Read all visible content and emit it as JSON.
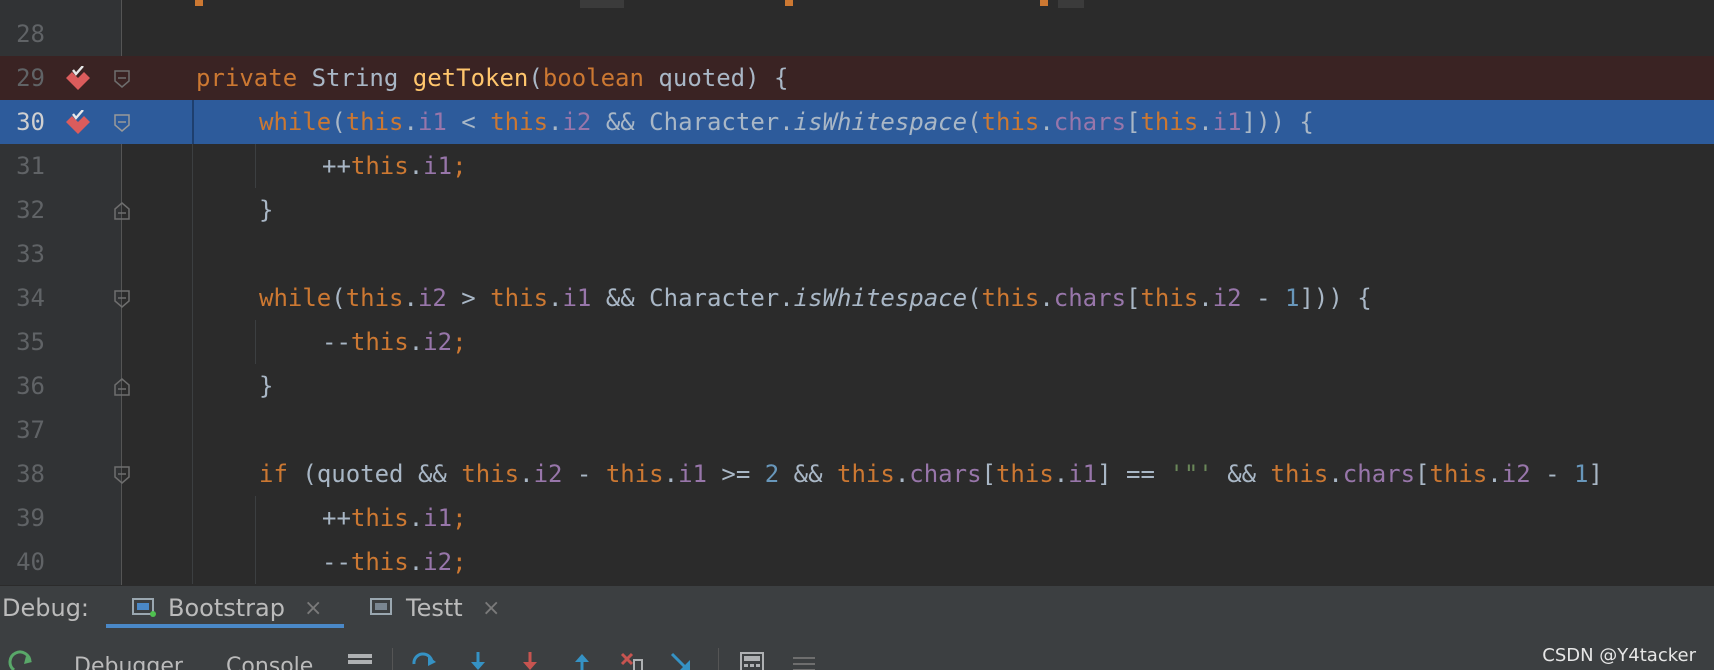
{
  "editor": {
    "lines": [
      {
        "n": "28"
      },
      {
        "n": "29"
      },
      {
        "n": "30"
      },
      {
        "n": "31"
      },
      {
        "n": "32"
      },
      {
        "n": "33"
      },
      {
        "n": "34"
      },
      {
        "n": "35"
      },
      {
        "n": "36"
      },
      {
        "n": "37"
      },
      {
        "n": "38"
      },
      {
        "n": "39"
      },
      {
        "n": "40"
      }
    ],
    "tokens": {
      "private": "private",
      "string": "String",
      "getToken": "getToken",
      "boolean": "boolean",
      "quoted": "quoted",
      "while": "while",
      "this": "this",
      "i1": "i1",
      "i2": "i2",
      "chars": "chars",
      "character": "Character",
      "isWhitespace": "isWhitespace",
      "if": "if",
      "one": "1",
      "two": "2",
      "quote_char": "'\"'"
    }
  },
  "debug": {
    "label": "Debug:",
    "tabs": [
      {
        "label": "Bootstrap",
        "active": true
      },
      {
        "label": "Testt",
        "active": false
      }
    ],
    "close_glyph": "×"
  },
  "toolbar": {
    "debugger_label": "Debugger",
    "console_label": "Console"
  },
  "watermark": "CSDN @Y4tacker",
  "colors": {
    "background": "#2b2b2b",
    "gutter": "#313335",
    "current_line": "#2d5b9b",
    "breakpoint_line": "#3a2323",
    "keyword": "#cc7832",
    "function": "#ffc66d",
    "field": "#9876aa",
    "number": "#6897bb",
    "string": "#6a8759",
    "plain": "#a9b7c6",
    "breakpoint": "#db5c5c",
    "tab_underline": "#4a88c7"
  }
}
